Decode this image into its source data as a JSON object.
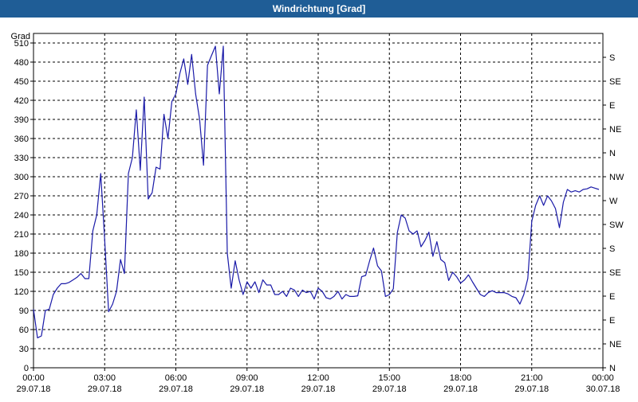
{
  "window": {
    "title": "Windrichtung [Grad]"
  },
  "chart_data": {
    "type": "line",
    "title": "Windrichtung [Grad]",
    "ylabel": "Grad",
    "ylim": [
      0,
      525
    ],
    "xlim": [
      "2018-07-29 00:00",
      "2018-07-30 00:00"
    ],
    "y_ticks": [
      0,
      30,
      60,
      90,
      120,
      150,
      180,
      210,
      240,
      270,
      300,
      330,
      360,
      390,
      420,
      450,
      480,
      510
    ],
    "x_ticks": [
      {
        "time": "00:00",
        "date": "29.07.18"
      },
      {
        "time": "03:00",
        "date": "29.07.18"
      },
      {
        "time": "06:00",
        "date": "29.07.18"
      },
      {
        "time": "09:00",
        "date": "29.07.18"
      },
      {
        "time": "12:00",
        "date": "29.07.18"
      },
      {
        "time": "15:00",
        "date": "29.07.18"
      },
      {
        "time": "18:00",
        "date": "29.07.18"
      },
      {
        "time": "21:00",
        "date": "29.07.18"
      },
      {
        "time": "00:00",
        "date": "30.07.18"
      }
    ],
    "right_axis": {
      "labels": [
        {
          "value": 0,
          "label": "N"
        },
        {
          "value": 30,
          "label": "NE"
        },
        {
          "value": 60,
          "label": "E"
        },
        {
          "value": 90,
          "label": "E"
        },
        {
          "value": 120,
          "label": "SE"
        },
        {
          "value": 150,
          "label": "S"
        },
        {
          "value": 180,
          "label": "SW"
        },
        {
          "value": 210,
          "label": "W"
        },
        {
          "value": 240,
          "label": "NW"
        },
        {
          "value": 270,
          "label": "N"
        },
        {
          "value": 300,
          "label": "NE"
        },
        {
          "value": 330,
          "label": "E"
        },
        {
          "value": 360,
          "label": "SE"
        },
        {
          "value": 390,
          "label": "S"
        }
      ]
    },
    "grid": true,
    "series_color": "#1a1aa8",
    "series": [
      {
        "name": "",
        "x": [
          "00:00",
          "00:10",
          "00:20",
          "00:30",
          "00:40",
          "00:50",
          "01:00",
          "01:10",
          "01:20",
          "01:30",
          "01:40",
          "01:50",
          "02:00",
          "02:10",
          "02:20",
          "02:30",
          "02:40",
          "02:50",
          "03:00",
          "03:10",
          "03:20",
          "03:30",
          "03:40",
          "03:50",
          "04:00",
          "04:10",
          "04:20",
          "04:30",
          "04:40",
          "04:50",
          "05:00",
          "05:10",
          "05:20",
          "05:30",
          "05:40",
          "05:50",
          "06:00",
          "06:10",
          "06:20",
          "06:30",
          "06:40",
          "06:50",
          "07:00",
          "07:10",
          "07:20",
          "07:30",
          "07:40",
          "07:50",
          "08:00",
          "08:10",
          "08:20",
          "08:30",
          "08:40",
          "08:50",
          "09:00",
          "09:10",
          "09:20",
          "09:30",
          "09:40",
          "09:50",
          "10:00",
          "10:10",
          "10:20",
          "10:30",
          "10:40",
          "10:50",
          "11:00",
          "11:10",
          "11:20",
          "11:30",
          "11:40",
          "11:50",
          "12:00",
          "12:10",
          "12:20",
          "12:30",
          "12:40",
          "12:50",
          "13:00",
          "13:10",
          "13:20",
          "13:30",
          "13:40",
          "13:50",
          "14:00",
          "14:10",
          "14:20",
          "14:30",
          "14:40",
          "14:50",
          "15:00",
          "15:10",
          "15:20",
          "15:30",
          "15:40",
          "15:50",
          "16:00",
          "16:10",
          "16:20",
          "16:30",
          "16:40",
          "16:50",
          "17:00",
          "17:10",
          "17:20",
          "17:30",
          "17:40",
          "17:50",
          "18:00",
          "18:10",
          "18:20",
          "18:30",
          "18:40",
          "18:50",
          "19:00",
          "19:10",
          "19:20",
          "19:30",
          "19:40",
          "19:50",
          "20:00",
          "20:10",
          "20:20",
          "20:30",
          "20:40",
          "20:50",
          "21:00",
          "21:10",
          "21:20",
          "21:30",
          "21:40",
          "21:50",
          "22:00",
          "22:10",
          "22:20",
          "22:30",
          "22:40",
          "22:50",
          "23:00",
          "23:10",
          "23:20",
          "23:30",
          "23:40",
          "23:50"
        ],
        "values": [
          92,
          47,
          50,
          90,
          92,
          115,
          125,
          132,
          132,
          134,
          138,
          142,
          148,
          140,
          140,
          215,
          240,
          305,
          200,
          88,
          100,
          120,
          170,
          148,
          305,
          330,
          405,
          310,
          425,
          265,
          275,
          315,
          312,
          398,
          360,
          418,
          430,
          462,
          485,
          445,
          492,
          430,
          390,
          318,
          475,
          490,
          505,
          430,
          505,
          180,
          125,
          168,
          138,
          115,
          135,
          125,
          135,
          118,
          138,
          130,
          130,
          115,
          115,
          120,
          112,
          125,
          122,
          112,
          122,
          118,
          120,
          108,
          125,
          120,
          110,
          108,
          112,
          120,
          108,
          115,
          112,
          112,
          113,
          143,
          145,
          168,
          188,
          160,
          152,
          112,
          115,
          124,
          212,
          240,
          235,
          215,
          210,
          215,
          190,
          200,
          213,
          175,
          198,
          170,
          165,
          137,
          150,
          143,
          133,
          138,
          146,
          135,
          125,
          115,
          112,
          118,
          121,
          118,
          118,
          118,
          116,
          112,
          110,
          100,
          115,
          140,
          230,
          255,
          270,
          255,
          270,
          262,
          250,
          220,
          260,
          280,
          276,
          278,
          276,
          280,
          281,
          284,
          282,
          280
        ]
      }
    ]
  }
}
